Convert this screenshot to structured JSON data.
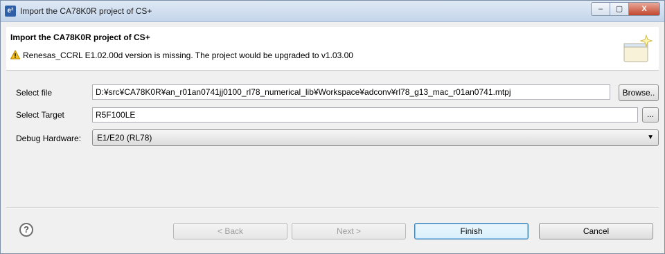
{
  "window": {
    "app_icon": "e²",
    "title": "Import the CA78K0R project of CS+",
    "minimize": "–",
    "maximize": "▢",
    "close": "X"
  },
  "header": {
    "title": "Import the CA78K0R project of CS+",
    "warning_icon": "warning-icon",
    "warning": "Renesas_CCRL E1.02.00d version is missing. The project would be upgraded to  v1.03.00"
  },
  "form": {
    "file_label": "Select file",
    "file_value": "D:¥src¥CA78K0R¥an_r01an0741jj0100_rl78_numerical_lib¥Workspace¥adconv¥rl78_g13_mac_r01an0741.mtpj",
    "browse_label": "Browse..",
    "target_label": "Select Target",
    "target_value": "R5F100LE",
    "target_browse_label": "...",
    "debug_label": "Debug Hardware:",
    "debug_value": "E1/E20 (RL78)",
    "debug_arrow": "▼"
  },
  "footer": {
    "help": "?",
    "back": "< Back",
    "next": "Next >",
    "finish": "Finish",
    "cancel": "Cancel"
  },
  "colors": {
    "titlebar": "#c4d5ea",
    "close_button": "#c2452c",
    "focus_border": "#3c7fb1"
  }
}
